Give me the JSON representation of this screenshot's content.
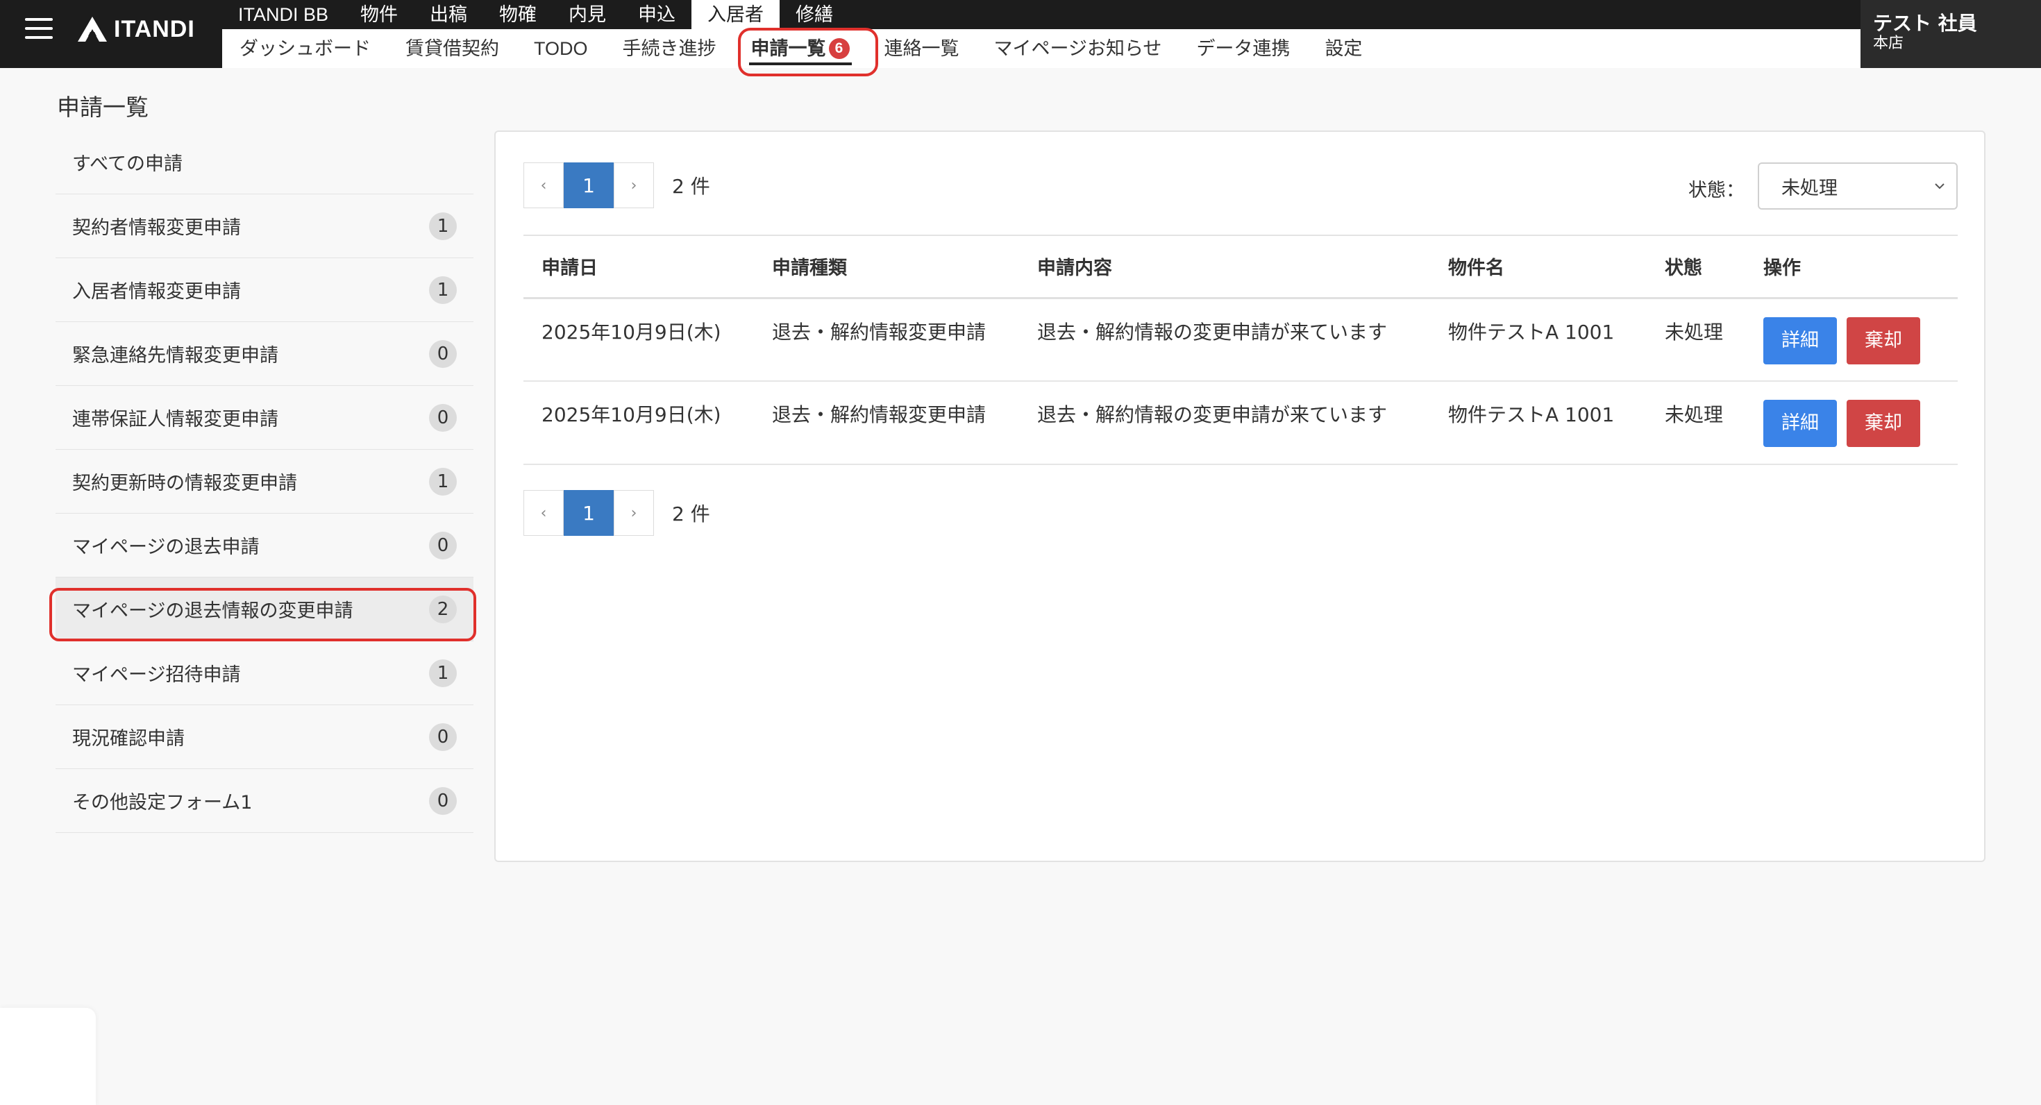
{
  "header": {
    "logo_text": "ITANDI",
    "products": [
      {
        "label": "ITANDI BB",
        "active": false
      },
      {
        "label": "物件",
        "active": false
      },
      {
        "label": "出稿",
        "active": false
      },
      {
        "label": "物確",
        "active": false
      },
      {
        "label": "内見",
        "active": false
      },
      {
        "label": "申込",
        "active": false
      },
      {
        "label": "入居者",
        "active": true
      },
      {
        "label": "修繕",
        "active": false
      }
    ],
    "subnav": [
      {
        "label": "ダッシュボード",
        "active": false
      },
      {
        "label": "賃貸借契約",
        "active": false
      },
      {
        "label": "TODO",
        "active": false
      },
      {
        "label": "手続き進捗",
        "active": false
      },
      {
        "label": "申請一覧",
        "active": true,
        "badge": "6"
      },
      {
        "label": "連絡一覧",
        "active": false
      },
      {
        "label": "マイページお知らせ",
        "active": false
      },
      {
        "label": "データ連携",
        "active": false
      },
      {
        "label": "設定",
        "active": false
      }
    ],
    "user": {
      "name": "テスト 社員",
      "branch": "本店"
    }
  },
  "page_title": "申請一覧",
  "sidebar": {
    "items": [
      {
        "label": "すべての申請",
        "count": null
      },
      {
        "label": "契約者情報変更申請",
        "count": "1"
      },
      {
        "label": "入居者情報変更申請",
        "count": "1"
      },
      {
        "label": "緊急連絡先情報変更申請",
        "count": "0"
      },
      {
        "label": "連帯保証人情報変更申請",
        "count": "0"
      },
      {
        "label": "契約更新時の情報変更申請",
        "count": "1"
      },
      {
        "label": "マイページの退去申請",
        "count": "0"
      },
      {
        "label": "マイページの退去情報の変更申請",
        "count": "2",
        "active": true
      },
      {
        "label": "マイページ招待申請",
        "count": "1"
      },
      {
        "label": "現況確認申請",
        "count": "0"
      },
      {
        "label": "その他設定フォーム1",
        "count": "0"
      }
    ]
  },
  "pagination": {
    "prev": "‹",
    "page": "1",
    "next": "›",
    "total_text": "2 件"
  },
  "filter": {
    "label": "状態：",
    "selected": "未処理"
  },
  "table": {
    "columns": [
      "申請日",
      "申請種類",
      "申請内容",
      "物件名",
      "状態",
      "操作"
    ],
    "rows": [
      {
        "date": "2025年10月9日(木)",
        "type": "退去・解約情報変更申請",
        "content": "退去・解約情報の変更申請が来ています",
        "property": "物件テストA 1001",
        "status": "未処理"
      },
      {
        "date": "2025年10月9日(木)",
        "type": "退去・解約情報変更申請",
        "content": "退去・解約情報の変更申請が来ています",
        "property": "物件テストA 1001",
        "status": "未処理"
      }
    ],
    "detail_label": "詳細",
    "reject_label": "棄却"
  },
  "colors": {
    "primary": "#3a7ac2",
    "detail_button": "#3a83e8",
    "reject_button": "#d04545",
    "highlight": "#e0302c",
    "nav_badge": "#d73f3f"
  }
}
